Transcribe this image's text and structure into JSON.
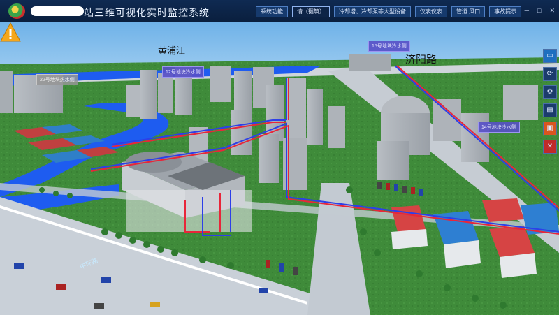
{
  "app": {
    "title": "站三维可视化实时监控系统"
  },
  "nav": [
    {
      "label": "系统功能",
      "active": false
    },
    {
      "label": "请（键筑）",
      "active": true
    },
    {
      "label": "冷却塔、冷却泵等大型设备",
      "active": false
    },
    {
      "label": "仪表仪表",
      "active": false
    },
    {
      "label": "管道 风口",
      "active": false
    },
    {
      "label": "事故提示",
      "active": false
    }
  ],
  "window_controls": {
    "minimize": "─",
    "maximize": "□",
    "close": "✕"
  },
  "map": {
    "river_label": "黄浦江",
    "road_label": "济阳路",
    "street_label": "中环路",
    "tags": [
      {
        "text": "22号地块热水侧",
        "style": "gray"
      },
      {
        "text": "12号地块冷水侧",
        "style": "purple"
      },
      {
        "text": "15号地块冷水侧",
        "style": "purple"
      },
      {
        "text": "14号地块冷水侧",
        "style": "purple"
      }
    ]
  },
  "colors": {
    "hot_pipe": "#e8263a",
    "cold_pipe": "#2d3fe8",
    "river": "#1e5cf0",
    "ground": "#3d8a3a",
    "road": "#c9d0d8"
  },
  "tools": [
    {
      "icon": "monitor-icon",
      "glyph": "▭"
    },
    {
      "icon": "rotate-icon",
      "glyph": "⟳"
    },
    {
      "icon": "settings-icon",
      "glyph": "⚙"
    },
    {
      "icon": "document-icon",
      "glyph": "▤"
    },
    {
      "icon": "clipboard-icon",
      "glyph": "▣"
    },
    {
      "icon": "close-tool-icon",
      "glyph": "✕"
    }
  ]
}
